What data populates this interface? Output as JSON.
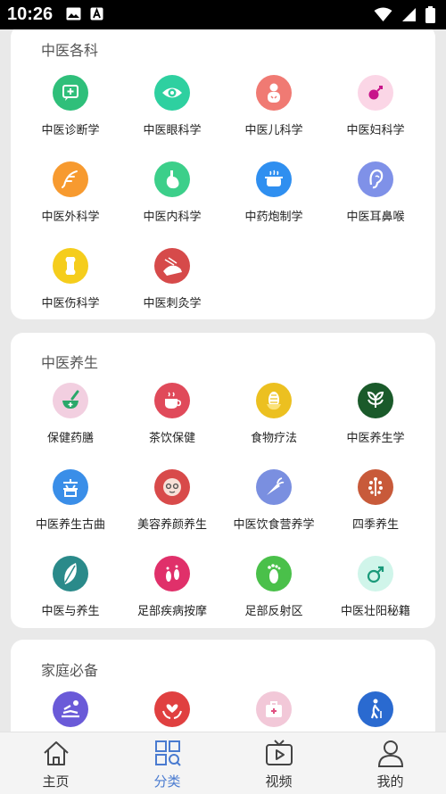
{
  "status": {
    "time": "10:26"
  },
  "sections": [
    {
      "title": "中医各科",
      "items": [
        {
          "label": "中医诊断学",
          "icon": "diagnosis-icon",
          "color": "#2fbf7a"
        },
        {
          "label": "中医眼科学",
          "icon": "eye-icon",
          "color": "#2ed0a0"
        },
        {
          "label": "中医儿科学",
          "icon": "baby-icon",
          "color": "#f07a73"
        },
        {
          "label": "中医妇科学",
          "icon": "female-icon",
          "color": "#fbd6e6"
        },
        {
          "label": "中医外科学",
          "icon": "feather-icon",
          "color": "#f79a2f"
        },
        {
          "label": "中医内科学",
          "icon": "stomach-icon",
          "color": "#3ccf8a"
        },
        {
          "label": "中药炮制学",
          "icon": "pot-icon",
          "color": "#2f8ff0"
        },
        {
          "label": "中医耳鼻喉",
          "icon": "ear-icon",
          "color": "#7f91e8"
        },
        {
          "label": "中医伤科学",
          "icon": "bone-icon",
          "color": "#f5cd1c"
        },
        {
          "label": "中医刺灸学",
          "icon": "acupuncture-icon",
          "color": "#d64a4a"
        }
      ]
    },
    {
      "title": "中医养生",
      "items": [
        {
          "label": "保健药膳",
          "icon": "mortar-icon",
          "color": "#f2cfe0"
        },
        {
          "label": "茶饮保健",
          "icon": "tea-icon",
          "color": "#e04a5a"
        },
        {
          "label": "食物疗法",
          "icon": "corn-icon",
          "color": "#ecc020"
        },
        {
          "label": "中医养生学",
          "icon": "leaf-icon",
          "color": "#1a5a2a"
        },
        {
          "label": "中医养生古曲",
          "icon": "music-icon",
          "color": "#3a8ee8"
        },
        {
          "label": "美容养颜养生",
          "icon": "face-mask-icon",
          "color": "#d84a4a"
        },
        {
          "label": "中医饮食营养学",
          "icon": "carrot-icon",
          "color": "#7a8fe0"
        },
        {
          "label": "四季养生",
          "icon": "tree-icon",
          "color": "#c85a3a"
        },
        {
          "label": "中医与养生",
          "icon": "leaf-art-icon",
          "color": "#2a8a8a"
        },
        {
          "label": "足部疾病按摩",
          "icon": "feet-icon",
          "color": "#e0306a"
        },
        {
          "label": "足部反射区",
          "icon": "foot-icon",
          "color": "#4ac04a"
        },
        {
          "label": "中医壮阳秘籍",
          "icon": "male-icon",
          "color": "#d0f5ea"
        }
      ]
    },
    {
      "title": "家庭必备",
      "items": [
        {
          "label": "",
          "icon": "massage-icon",
          "color": "#6a5ad8"
        },
        {
          "label": "",
          "icon": "care-hands-icon",
          "color": "#e04040"
        },
        {
          "label": "",
          "icon": "first-aid-icon",
          "color": "#f2c8d8"
        },
        {
          "label": "",
          "icon": "elder-icon",
          "color": "#2a6ad0"
        }
      ]
    }
  ],
  "nav": [
    {
      "label": "主页",
      "icon": "home-icon",
      "active": false
    },
    {
      "label": "分类",
      "icon": "category-icon",
      "active": true
    },
    {
      "label": "视频",
      "icon": "video-icon",
      "active": false
    },
    {
      "label": "我的",
      "icon": "profile-icon",
      "active": false
    }
  ],
  "colors": {
    "accent": "#4a7bd0",
    "nav_inactive": "#333333"
  }
}
